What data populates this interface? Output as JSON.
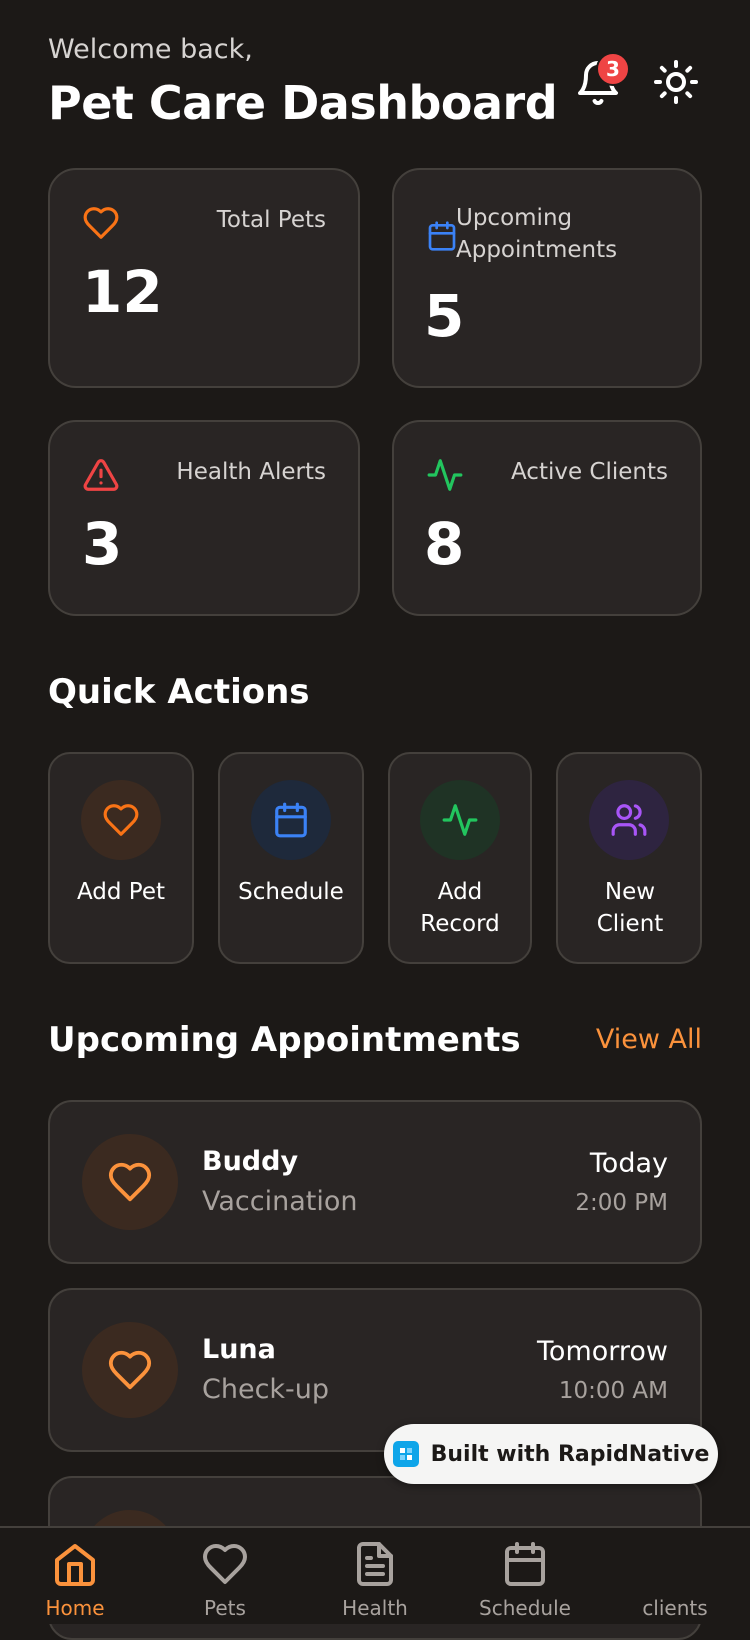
{
  "header": {
    "welcome": "Welcome back,",
    "title": "Pet Care Dashboard",
    "notification_count": "3"
  },
  "stats": [
    {
      "label": "Total Pets",
      "value": "12",
      "icon": "heart-icon",
      "color": "#f97316"
    },
    {
      "label": "Upcoming Appointments",
      "value": "5",
      "icon": "calendar-icon",
      "color": "#3b82f6"
    },
    {
      "label": "Health Alerts",
      "value": "3",
      "icon": "alert-triangle-icon",
      "color": "#ef4444"
    },
    {
      "label": "Active Clients",
      "value": "8",
      "icon": "activity-icon",
      "color": "#22c55e"
    }
  ],
  "quick_actions": {
    "title": "Quick Actions",
    "items": [
      {
        "label": "Add Pet",
        "icon": "heart-icon",
        "color": "#f97316"
      },
      {
        "label": "Schedule",
        "icon": "calendar-icon",
        "color": "#3b82f6"
      },
      {
        "label": "Add Record",
        "icon": "activity-icon",
        "color": "#22c55e"
      },
      {
        "label": "New Client",
        "icon": "users-icon",
        "color": "#a855f7"
      }
    ]
  },
  "appointments": {
    "title": "Upcoming Appointments",
    "view_all": "View All",
    "items": [
      {
        "pet": "Buddy",
        "type": "Vaccination",
        "day": "Today",
        "time": "2:00 PM"
      },
      {
        "pet": "Luna",
        "type": "Check-up",
        "day": "Tomorrow",
        "time": "10:00 AM"
      }
    ]
  },
  "badge": {
    "label": "Built with RapidNative"
  },
  "tabs": [
    {
      "label": "Home",
      "icon": "home-icon",
      "active": true
    },
    {
      "label": "Pets",
      "icon": "heart-icon",
      "active": false
    },
    {
      "label": "Health",
      "icon": "file-text-icon",
      "active": false
    },
    {
      "label": "Schedule",
      "icon": "calendar-icon",
      "active": false
    },
    {
      "label": "clients",
      "icon": "users-icon",
      "active": false
    }
  ],
  "colors": {
    "background": "#1c1917",
    "card": "#292524",
    "accent": "#fb923c"
  }
}
